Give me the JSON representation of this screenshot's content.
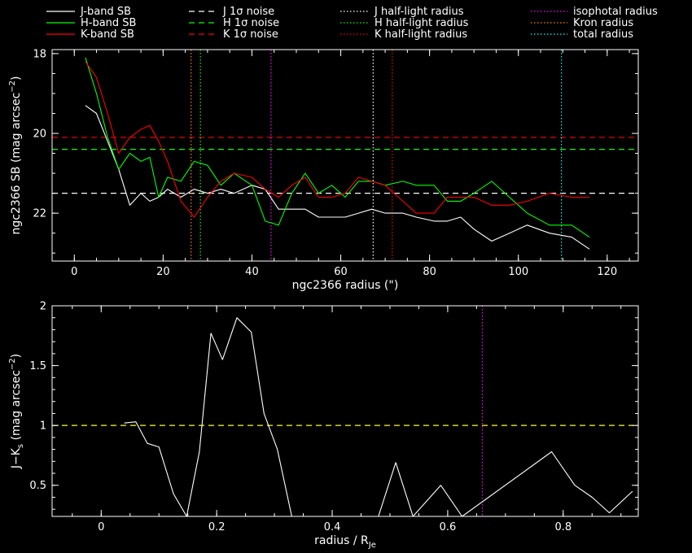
{
  "chart_data": [
    {
      "type": "line",
      "xlabel": "ngc2366 radius (\")",
      "ylabel": "ngc2366 SB (mag arcsec",
      "ylabel_sup": "−2",
      "ylabel_end": ")",
      "xlim": [
        -5,
        127
      ],
      "ylim": [
        23.2,
        17.9
      ],
      "xticks": [
        0,
        20,
        40,
        60,
        80,
        100,
        120
      ],
      "yticks": [
        18,
        20,
        22
      ],
      "legend": [
        {
          "label": "J-band SB",
          "color": "#ffffff",
          "style": "solid"
        },
        {
          "label": "H-band SB",
          "color": "#00ff00",
          "style": "solid"
        },
        {
          "label": "K-band SB",
          "color": "#ff0000",
          "style": "solid"
        },
        {
          "label": "J 1σ noise",
          "color": "#ffffff",
          "style": "dashed"
        },
        {
          "label": "H 1σ noise",
          "color": "#00ff00",
          "style": "dashed"
        },
        {
          "label": "K 1σ noise",
          "color": "#ff0000",
          "style": "dashed"
        },
        {
          "label": "J half-light radius",
          "color": "#ffffff",
          "style": "dotted"
        },
        {
          "label": "H half-light radius",
          "color": "#00ff00",
          "style": "dotted"
        },
        {
          "label": "K half-light radius",
          "color": "#ff0000",
          "style": "dotted"
        },
        {
          "label": "isophotal radius",
          "color": "#ff00ff",
          "style": "dotted"
        },
        {
          "label": "Kron radius",
          "color": "#ff8000",
          "style": "dotted"
        },
        {
          "label": "total radius",
          "color": "#00ffff",
          "style": "dotted"
        }
      ],
      "series": [
        {
          "name": "J-band SB",
          "color": "#ffffff",
          "x": [
            2.5,
            5,
            7.5,
            10,
            12.5,
            15,
            17,
            19,
            21,
            24,
            27,
            30,
            33,
            36,
            40,
            43,
            46,
            49,
            52,
            55,
            58,
            61,
            64,
            67,
            70,
            74,
            77,
            81,
            84,
            87,
            90,
            94,
            98,
            102,
            107,
            112,
            116
          ],
          "y": [
            19.3,
            19.5,
            20.2,
            20.9,
            21.8,
            21.5,
            21.7,
            21.6,
            21.4,
            21.6,
            21.4,
            21.5,
            21.4,
            21.5,
            21.3,
            21.4,
            21.9,
            21.9,
            21.9,
            22.1,
            22.1,
            22.1,
            22.0,
            21.9,
            22.0,
            22.0,
            22.1,
            22.2,
            22.2,
            22.1,
            22.4,
            22.7,
            22.5,
            22.3,
            22.5,
            22.6,
            22.9
          ]
        },
        {
          "name": "H-band SB",
          "color": "#00ff00",
          "x": [
            2.5,
            5,
            7.5,
            10,
            12.5,
            15,
            17,
            19,
            21,
            24,
            27,
            30,
            33,
            36,
            40,
            43,
            46,
            49,
            52,
            55,
            58,
            61,
            64,
            67,
            70,
            74,
            77,
            81,
            84,
            87,
            90,
            94,
            98,
            102,
            107,
            112,
            116
          ],
          "y": [
            18.1,
            19.0,
            20.1,
            20.9,
            20.5,
            20.7,
            20.6,
            21.6,
            21.1,
            21.2,
            20.7,
            20.8,
            21.3,
            21.0,
            21.3,
            22.2,
            22.3,
            21.5,
            21.0,
            21.5,
            21.3,
            21.6,
            21.2,
            21.2,
            21.3,
            21.2,
            21.3,
            21.3,
            21.7,
            21.7,
            21.5,
            21.2,
            21.6,
            22.0,
            22.3,
            22.3,
            22.6
          ]
        },
        {
          "name": "K-band SB",
          "color": "#ff0000",
          "x": [
            2.5,
            5,
            7.5,
            10,
            12.5,
            15,
            17,
            19,
            21,
            24,
            27,
            30,
            33,
            36,
            40,
            43,
            46,
            49,
            52,
            55,
            58,
            61,
            64,
            67,
            70,
            74,
            77,
            81,
            84,
            87,
            90,
            94,
            98,
            102,
            107,
            112,
            116
          ],
          "y": [
            18.2,
            18.6,
            19.5,
            20.5,
            20.1,
            19.9,
            19.8,
            20.2,
            20.7,
            21.7,
            22.1,
            21.6,
            21.2,
            21.0,
            21.1,
            21.4,
            21.6,
            21.3,
            21.1,
            21.6,
            21.6,
            21.5,
            21.1,
            21.2,
            21.3,
            21.7,
            22.0,
            22.0,
            21.6,
            21.6,
            21.6,
            21.8,
            21.8,
            21.7,
            21.5,
            21.6,
            21.6
          ]
        }
      ],
      "hlines": [
        {
          "name": "J 1σ noise",
          "y": 21.5,
          "color": "#ffffff",
          "style": "dashed"
        },
        {
          "name": "H 1σ noise",
          "y": 20.4,
          "color": "#00ff00",
          "style": "dashed"
        },
        {
          "name": "K 1σ noise",
          "y": 20.1,
          "color": "#ff0000",
          "style": "dashed"
        }
      ],
      "vlines": [
        {
          "name": "Kron radius",
          "x": 26.3,
          "color": "#ff8000",
          "style": "dotted"
        },
        {
          "name": "H half-light radius",
          "x": 28.4,
          "color": "#00ff00",
          "style": "dotted"
        },
        {
          "name": "isophotal radius",
          "x": 44.3,
          "color": "#ff00ff",
          "style": "dotted"
        },
        {
          "name": "J half-light radius",
          "x": 67.3,
          "color": "#ffffff",
          "style": "dotted"
        },
        {
          "name": "K half-light radius",
          "x": 71.6,
          "color": "#ff0000",
          "style": "dotted"
        },
        {
          "name": "total radius",
          "x": 109.7,
          "color": "#00ffff",
          "style": "dotted"
        }
      ]
    },
    {
      "type": "line",
      "xlabel": "radius / R",
      "xlabel_sub": "Je",
      "ylabel": "J−K",
      "ylabel_sub": "s",
      "ylabel_rest": " (mag arcsec",
      "ylabel_sup": "−2",
      "ylabel_end": ")",
      "xlim": [
        -0.085,
        0.93
      ],
      "ylim": [
        0.24,
        2
      ],
      "xticks": [
        "0",
        "0.2",
        "0.4",
        "0.6",
        "0.8"
      ],
      "yticks": [
        "0.5",
        "1",
        "1.5",
        "2"
      ],
      "series": [
        {
          "name": "J-Ks",
          "color": "#ffffff",
          "x": [
            0.04,
            0.06,
            0.08,
            0.1,
            0.125,
            0.148,
            0.17,
            0.19,
            0.21,
            0.235,
            0.26,
            0.282,
            0.305,
            0.33,
            0.48,
            0.51,
            0.54,
            0.588,
            0.625,
            0.78,
            0.82,
            0.85,
            0.88,
            0.92
          ],
          "y": [
            1.02,
            1.03,
            0.85,
            0.82,
            0.43,
            0.24,
            0.78,
            1.77,
            1.55,
            1.9,
            1.78,
            1.1,
            0.8,
            0.24,
            0.24,
            0.69,
            0.24,
            0.5,
            0.24,
            0.78,
            0.5,
            0.4,
            0.27,
            0.45
          ]
        }
      ],
      "hlines": [
        {
          "name": "J-Ks reference",
          "y": 1.0,
          "color": "#ffff00",
          "style": "dashed"
        }
      ],
      "vlines": [
        {
          "name": "isophotal radius",
          "x": 0.66,
          "color": "#ff00ff",
          "style": "dotted"
        }
      ]
    }
  ]
}
